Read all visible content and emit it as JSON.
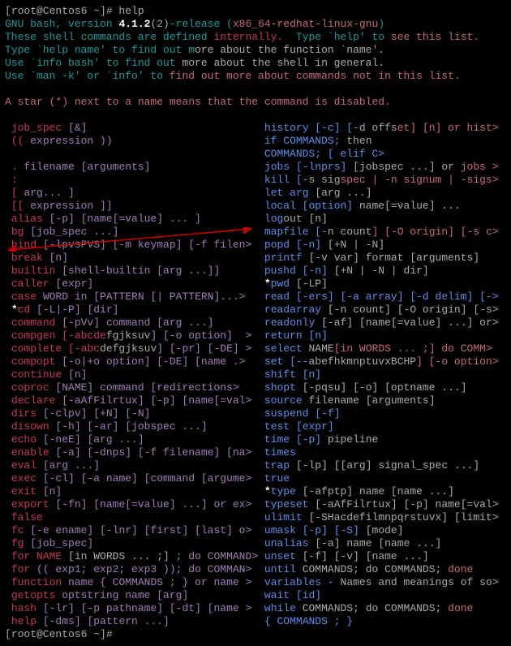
{
  "prompt1": "[root@Centos6 ~]# help",
  "prompt2": "[root@Centos6 ~]#",
  "header1": "GNU bash, version ",
  "ver": "4.1.2",
  "verR": "(2)",
  "header2": "-release (",
  "arch": "x86_64-redhat-linux-gnu",
  "header3": ")",
  "l1a": "These shell commands are defined ",
  "l1b": "internally.",
  "l1c": "  Type `help' to ",
  "l1d": "see this list.",
  "l2a": "Type `help name' to find out m",
  "l2b": "ore about the function `name'.",
  "l3a": "Use `info bash' to find out ",
  "l3b": "more about the shell in general.",
  "l4a": "Use `man -k' or `info' to ",
  "l4b": "find out more about commands not in this list.",
  "star": "A star (*) next to a name means that the command is disabled.",
  "tbl": [
    [
      "job_spec [&]",
      "history [-c] [-",
      "d offs",
      "et] [n] or hist>"
    ],
    [
      "(( expression ))",
      "if COMMANDS; ",
      "then",
      ""
    ],
    [
      "",
      "COMMANDS; [ elif C>",
      "",
      ""
    ],
    [
      ". filename [arguments]",
      "jobs [-lnprs] ",
      "[jobspec ...] or ",
      "jobs >"
    ],
    [
      ":",
      "kill [-",
      "s sig",
      "spec | -n signum | -sigs>"
    ],
    [
      "[ arg... ]",
      "let arg ",
      "[arg ...]",
      ""
    ],
    [
      "[[ expression ]]",
      "local [option] ",
      "name[=value] ...",
      ""
    ],
    [
      "alias [-p] [name[=value] ... ]",
      "log",
      "out [n]",
      ""
    ],
    [
      "bg [job_spec ...]",
      "mapfile [-",
      "n count",
      "] [-O origin] [-s c>"
    ],
    [
      "bind [-lpvsPVS] [-m keymap] [-f filen>",
      "popd [-n] ",
      "[+N | -N]",
      ""
    ],
    [
      "break [n]",
      "printf ",
      "[-v var] format [arguments]",
      ""
    ],
    [
      "builtin [shell-builtin [arg ...]]",
      "pushd [-n] ",
      "[+N | -N | dir]",
      ""
    ],
    [
      "caller [expr]",
      "*pwd ",
      "[-LP]",
      ""
    ],
    [
      "case WORD in [PATTERN [| PATTERN]...>",
      "read [-ers] [-a array] [-d delim] [->",
      "",
      ""
    ],
    [
      "*cd [-L|-P] [dir]",
      "readarray ",
      "[-n count] [-O origin] [-s>",
      ""
    ],
    [
      "command [-pVv] command [arg ...]",
      "readonly ",
      "[-af] [name[=value] ...] or>",
      ""
    ],
    [
      "compgen [-abcde",
      "fgjksuv",
      "] [-o option]  >",
      "return [n]",
      "",
      ""
    ],
    [
      "complete [-abc",
      "defgjksuv",
      "] [-pr] [-DE] >",
      "select ",
      "NAME",
      "[in WORDS ... ;] do COMM>"
    ],
    [
      "compopt [-o|+o option] [-DE] [name .>",
      "set [--",
      "abefhkmnptuvxBCHP",
      "] [-o option>"
    ],
    [
      "continue [n]",
      "shift [n]",
      "",
      ""
    ],
    [
      "coproc [NAME] command [redirections>",
      "shopt ",
      "[-pqsu] [-o] [optname ...]",
      ""
    ],
    [
      "declare [-aAfFilrtux] [-p] [name[=val>",
      "source ",
      "filename [arguments]",
      ""
    ],
    [
      "dirs [-clpv] [+N] [-N]",
      "suspend [-f]",
      "",
      ""
    ],
    [
      "disown [-h] [-ar] [jobspec ...]",
      "test [expr]",
      "",
      ""
    ],
    [
      "echo [-neE] [arg ...]",
      "time [-p] ",
      "pipeline",
      ""
    ],
    [
      "enable [-a] [-dnps] [-f filename] [na>",
      "times",
      "",
      ""
    ],
    [
      "eval [arg ...]",
      "trap ",
      "[-lp] [[arg] signal_spec ...]",
      ""
    ],
    [
      "exec [-cl] [-a name] [command [argume>",
      "true",
      "",
      ""
    ],
    [
      "exit [n]",
      "*type ",
      "[-afptp] name [name ...]",
      ""
    ],
    [
      "export [-fn] [name[=value] ...] or ex>",
      "typeset ",
      "[-aAfFilrtux] [-p] name[=val>",
      ""
    ],
    [
      "false",
      "ulimit ",
      "[-SHacdefilmnpqrstuvx] [limit>",
      ""
    ],
    [
      "fc [-e ename] [-lnr] [first] [last] o>",
      "umask [-p] [-S] ",
      "[mode]",
      ""
    ],
    [
      "fg [job_spec]",
      "unalias ",
      "[-a] name [name ...]",
      ""
    ],
    [
      "for NAME ",
      "[in WORDS ... ;]",
      " ; do COMMAND>",
      "unset ",
      "[-f] [-v] [name ...]",
      ""
    ],
    [
      "for (( exp1; exp2; exp3 )); do COMMAN>",
      "until ",
      "COMMANDS; do COMMANDS; ",
      "done"
    ],
    [
      "function name { COMMANDS ; } or name >",
      "variables - ",
      "Names and meanings of so>",
      ""
    ],
    [
      "getopts optstring name [arg]",
      "wait [id]",
      "",
      ""
    ],
    [
      "hash [-lr] [-p pathname] [-dt] [name >",
      "while ",
      "COMMANDS; do COMMANDS; ",
      "done"
    ],
    [
      "help [-dms] [pattern ...]",
      "{ COMMANDS ; }",
      "",
      ""
    ]
  ]
}
